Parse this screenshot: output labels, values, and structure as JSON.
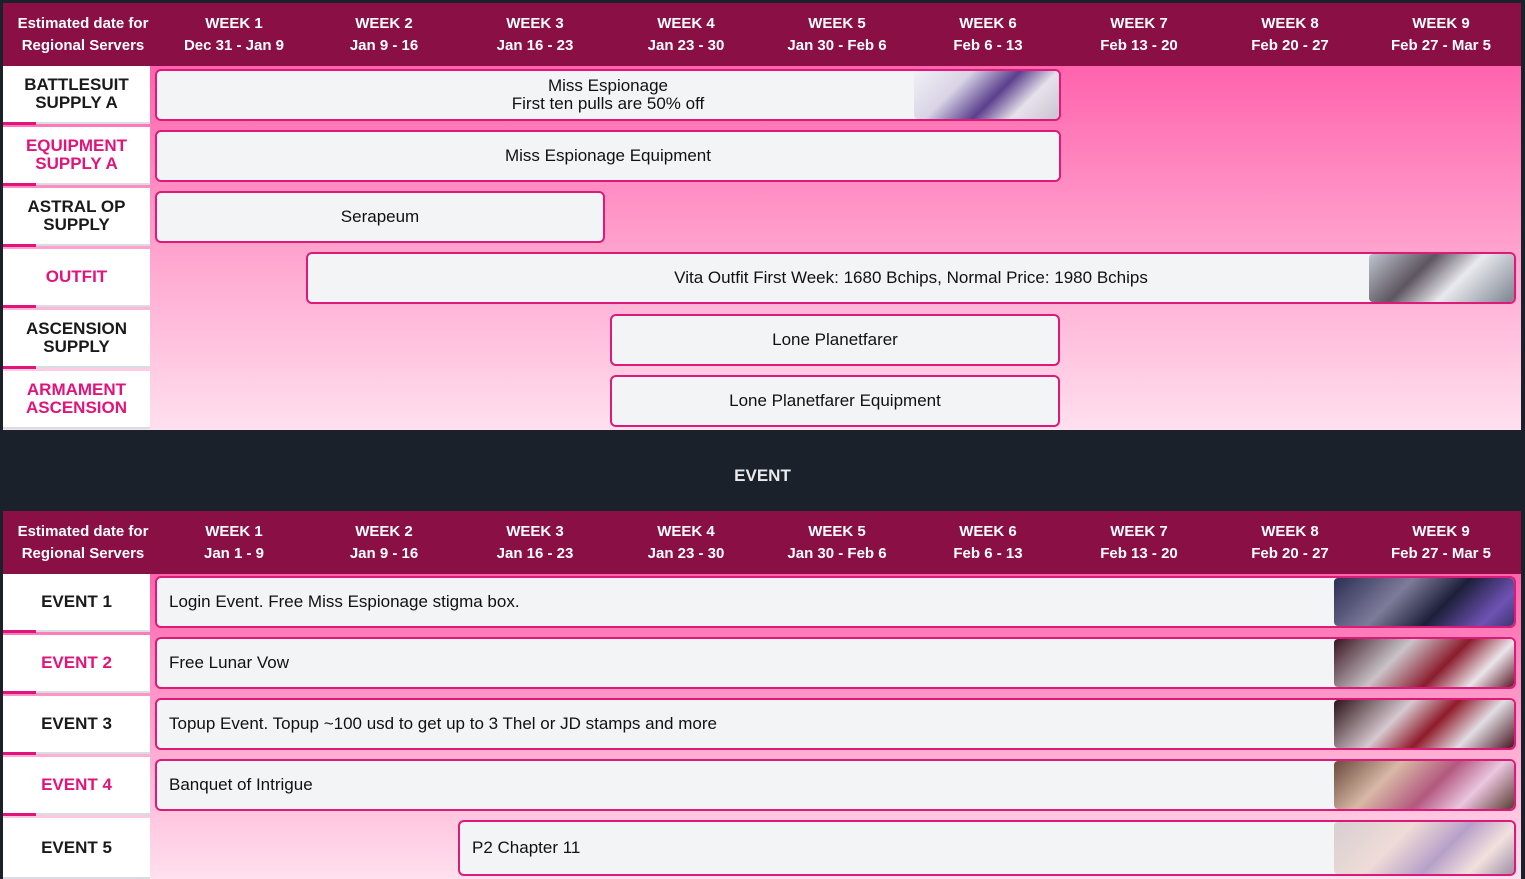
{
  "supply": {
    "header": {
      "first_line1": "Estimated date for",
      "first_line2": "Regional Servers",
      "weeks": [
        {
          "label": "WEEK 1",
          "dates": "Dec 31 - Jan 9"
        },
        {
          "label": "WEEK 2",
          "dates": "Jan 9 - 16"
        },
        {
          "label": "WEEK 3",
          "dates": "Jan 16 - 23"
        },
        {
          "label": "WEEK 4",
          "dates": "Jan 23 - 30"
        },
        {
          "label": "WEEK 5",
          "dates": "Jan 30 - Feb 6"
        },
        {
          "label": "WEEK 6",
          "dates": "Feb 6 - 13"
        },
        {
          "label": "WEEK 7",
          "dates": "Feb 13 - 20"
        },
        {
          "label": "WEEK 8",
          "dates": "Feb 20 - 27"
        },
        {
          "label": "WEEK 9",
          "dates": "Feb 27 - Mar 5"
        }
      ]
    },
    "rows": [
      {
        "label_line1": "BATTLESUIT",
        "label_line2": "SUPPLY A",
        "bar_line1": "Miss Espionage",
        "bar_line2": "First ten pulls are 50% off"
      },
      {
        "label_line1": "EQUIPMENT",
        "label_line2": "SUPPLY A",
        "bar_line1": "Miss Espionage Equipment"
      },
      {
        "label_line1": "ASTRAL OP",
        "label_line2": "SUPPLY",
        "bar_line1": "Serapeum"
      },
      {
        "label_line1": "OUTFIT",
        "bar_line1": "Vita Outfit First Week: 1680 Bchips, Normal Price: 1980 Bchips"
      },
      {
        "label_line1": "ASCENSION",
        "label_line2": "SUPPLY",
        "bar_line1": "Lone Planetfarer"
      },
      {
        "label_line1": "ARMAMENT",
        "label_line2": "ASCENSION",
        "bar_line1": "Lone Planetfarer Equipment"
      }
    ]
  },
  "event_title": "EVENT",
  "events": {
    "header": {
      "first_line1": "Estimated date for",
      "first_line2": "Regional Servers",
      "weeks": [
        {
          "label": "WEEK 1",
          "dates": "Jan 1 - 9"
        },
        {
          "label": "WEEK 2",
          "dates": "Jan 9 - 16"
        },
        {
          "label": "WEEK 3",
          "dates": "Jan 16 - 23"
        },
        {
          "label": "WEEK 4",
          "dates": "Jan 23 - 30"
        },
        {
          "label": "WEEK 5",
          "dates": "Jan 30 - Feb 6"
        },
        {
          "label": "WEEK 6",
          "dates": "Feb 6 - 13"
        },
        {
          "label": "WEEK 7",
          "dates": "Feb 13 - 20"
        },
        {
          "label": "WEEK 8",
          "dates": "Feb 20 - 27"
        },
        {
          "label": "WEEK 9",
          "dates": "Feb 27 - Mar 5"
        }
      ]
    },
    "rows": [
      {
        "label": "EVENT 1",
        "bar": "Login Event. Free Miss Espionage stigma box."
      },
      {
        "label": "EVENT 2",
        "bar": "Free Lunar Vow"
      },
      {
        "label": "EVENT 3",
        "bar": "Topup Event. Topup ~100 usd to get up to 3 Thel or JD stamps and more"
      },
      {
        "label": "EVENT 4",
        "bar": "Banquet of Intrigue"
      },
      {
        "label": "EVENT 5",
        "bar": "P2 Chapter 11"
      }
    ]
  },
  "colors": {
    "header_bg": "#8a0f45",
    "accent_pink": "#e0147a",
    "bar_border": "#dd1a78",
    "page_bg": "#1b212a"
  }
}
